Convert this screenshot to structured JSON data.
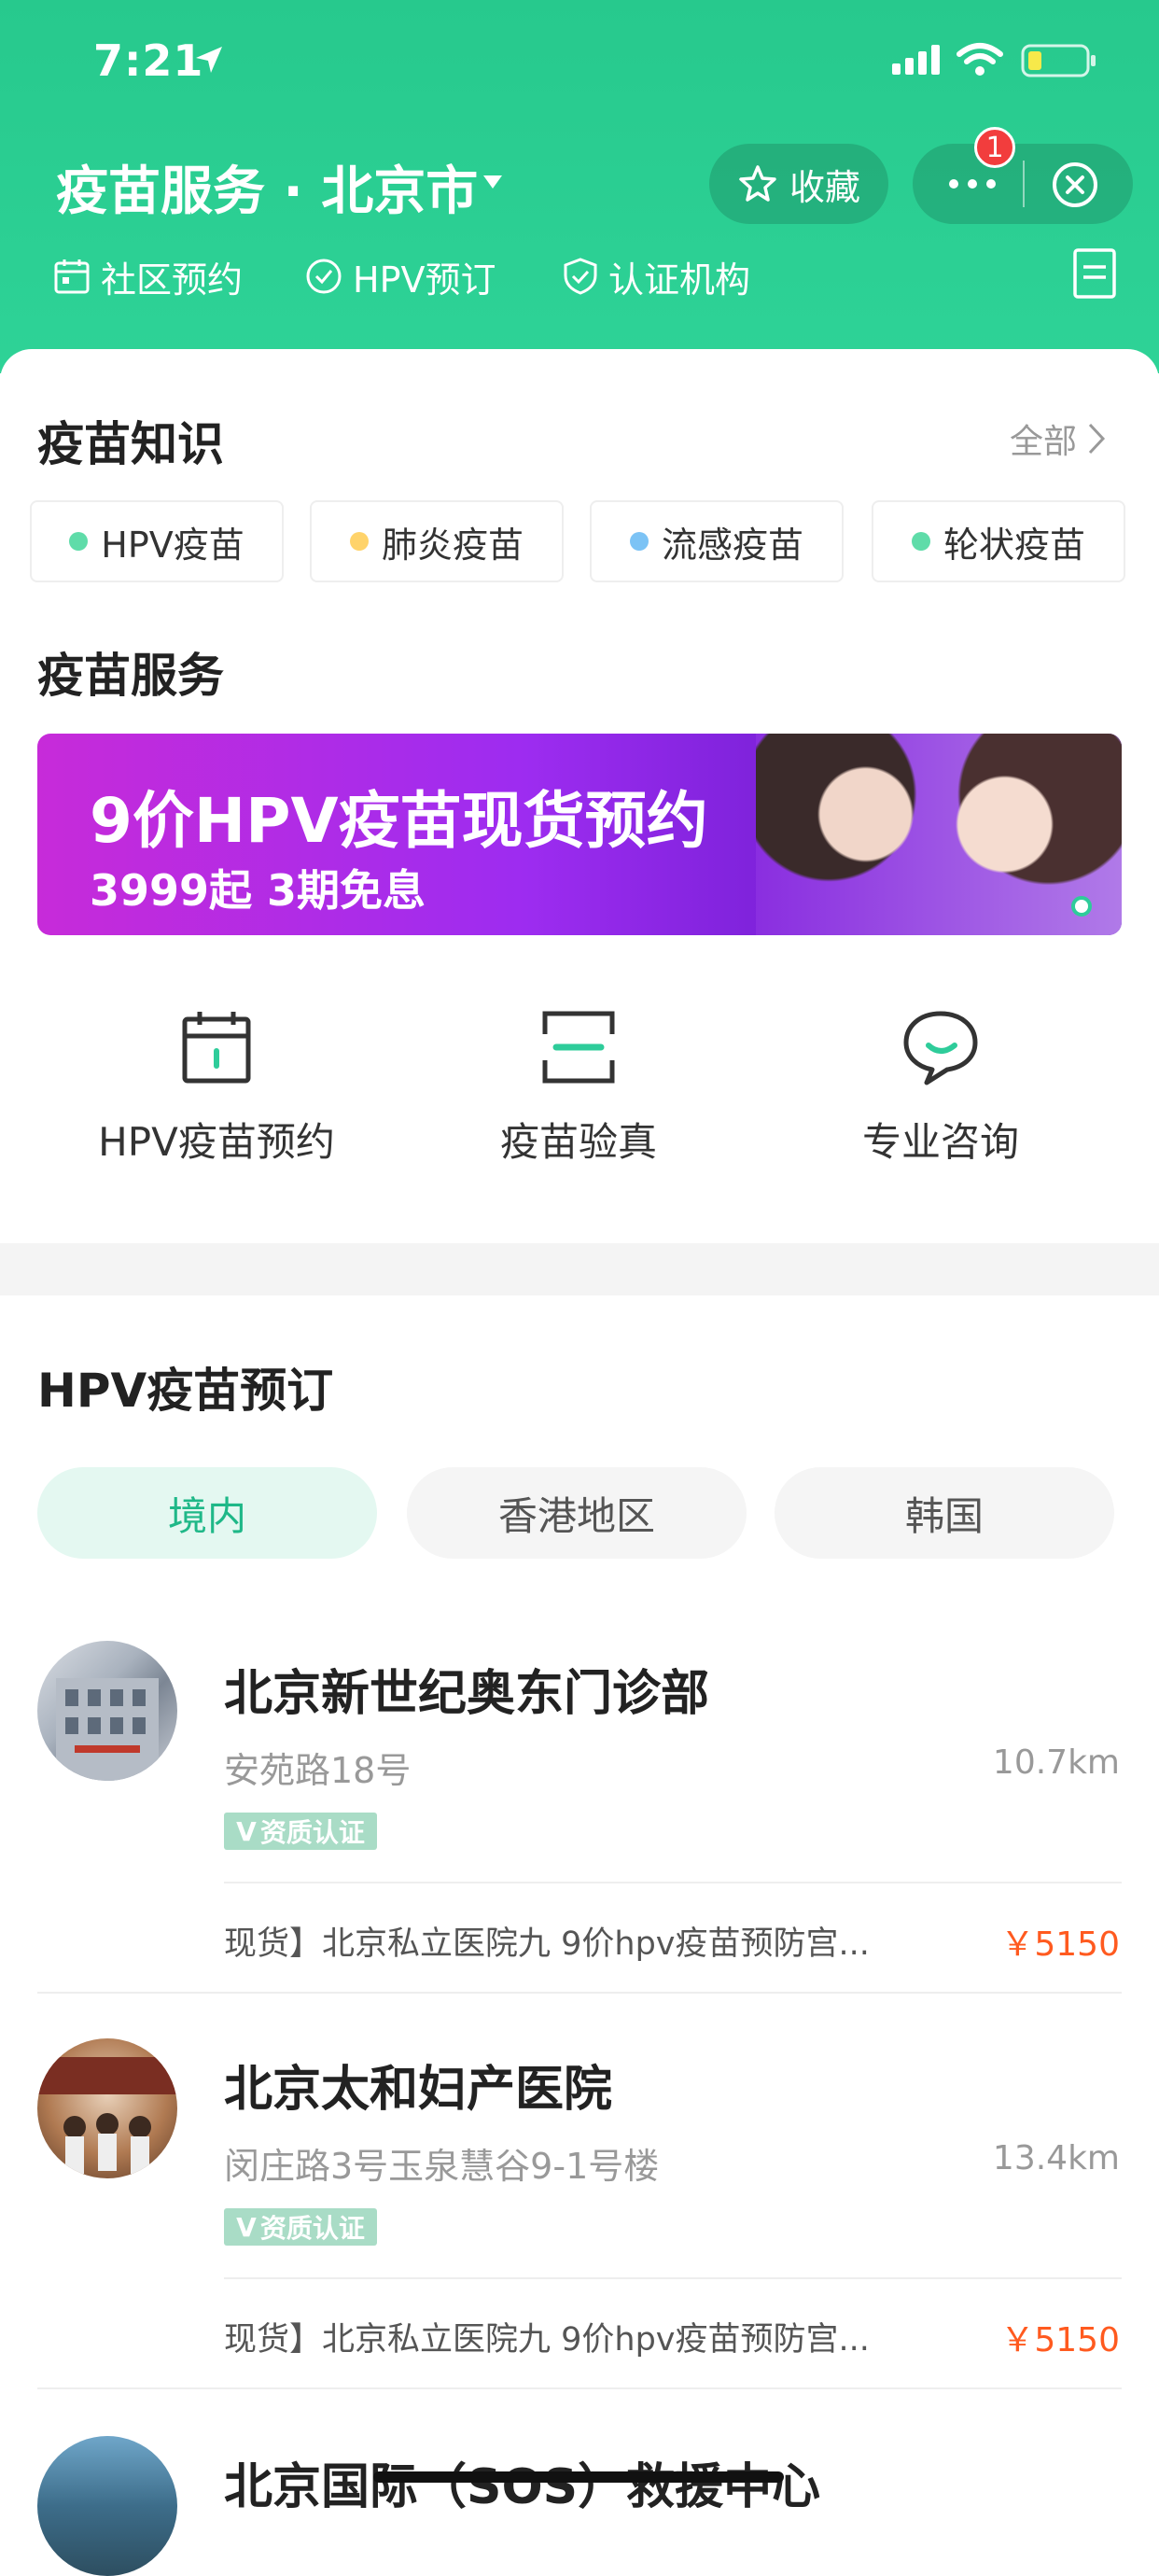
{
  "status_bar": {
    "time": "7:21"
  },
  "header": {
    "title": "疫苗服务 · 北京市",
    "favorite_label": "收藏",
    "badge_count": "1",
    "subnav": [
      {
        "label": "社区预约",
        "icon": "calendar-icon"
      },
      {
        "label": "HPV预订",
        "icon": "check-circle-icon"
      },
      {
        "label": "认证机构",
        "icon": "shield-check-icon"
      }
    ]
  },
  "knowledge": {
    "title": "疫苗知识",
    "more_label": "全部",
    "chips": [
      {
        "label": "HPV疫苗",
        "dot_color": "#5fdca9"
      },
      {
        "label": "肺炎疫苗",
        "dot_color": "#ffd36a"
      },
      {
        "label": "流感疫苗",
        "dot_color": "#7cc3f5"
      },
      {
        "label": "轮状疫苗",
        "dot_color": "#5fdca9"
      }
    ]
  },
  "services": {
    "title": "疫苗服务",
    "banner": {
      "line1": "9价HPV疫苗现货预约",
      "line2": "3999起 3期免息"
    },
    "items": [
      {
        "label": "HPV疫苗预约",
        "icon": "calendar-icon"
      },
      {
        "label": "疫苗验真",
        "icon": "scan-icon"
      },
      {
        "label": "专业咨询",
        "icon": "chat-icon"
      }
    ]
  },
  "hpv_booking": {
    "title": "HPV疫苗预订",
    "tabs": [
      "境内",
      "香港地区",
      "韩国"
    ],
    "active_tab": 0,
    "clinics": [
      {
        "name": "北京新世纪奥东门诊部",
        "address": "安苑路18号",
        "distance": "10.7km",
        "cert": "资质认证",
        "product": "现货】北京私立医院九 9价hpv疫苗预防宫...",
        "price": "￥5150"
      },
      {
        "name": "北京太和妇产医院",
        "address": "闵庄路3号玉泉慧谷9-1号楼",
        "distance": "13.4km",
        "cert": "资质认证",
        "product": "现货】北京私立医院九 9价hpv疫苗预防宫...",
        "price": "￥5150"
      },
      {
        "name": "北京国际（SOS）救援中心"
      }
    ]
  },
  "colors": {
    "brand_green": "#2ed397",
    "price_orange": "#ff5a1f"
  }
}
